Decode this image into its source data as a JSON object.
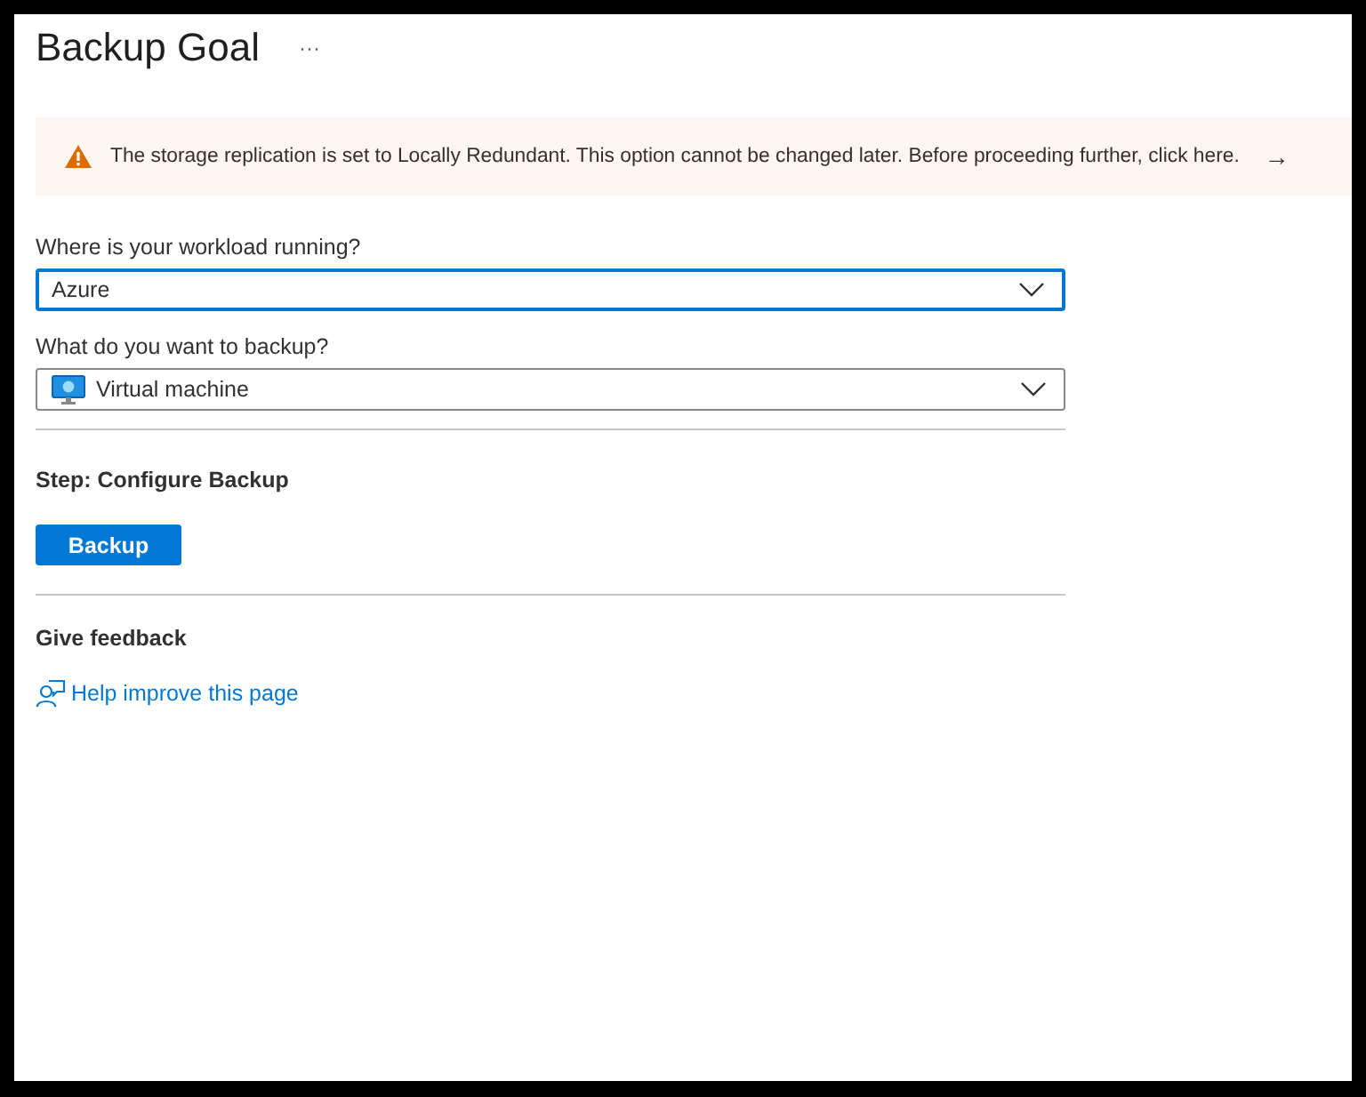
{
  "title": "Backup Goal",
  "more_menu": "···",
  "banner": {
    "kind": "warning",
    "text": "The storage replication is set to Locally Redundant. This option cannot be changed later. Before proceeding further, click here.",
    "arrow": "→"
  },
  "fields": [
    {
      "label": "Where is your workload running?",
      "value": "Azure",
      "focused": true,
      "kind": "plain"
    },
    {
      "label": "What do you want to backup?",
      "value": "Virtual machine",
      "focused": false,
      "kind": "vm"
    }
  ],
  "step": {
    "heading": "Step: Configure Backup",
    "button": "Backup"
  },
  "feedback": {
    "heading": "Give feedback",
    "link": "Help improve this page"
  }
}
